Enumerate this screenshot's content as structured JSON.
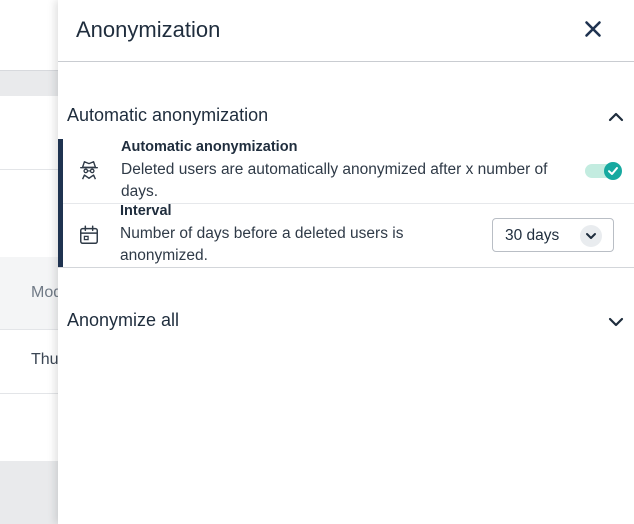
{
  "background": {
    "header_cell": "Mod",
    "row_cell": "Thu"
  },
  "drawer": {
    "title": "Anonymization",
    "close_icon": "close-icon"
  },
  "sections": [
    {
      "title": "Automatic anonymization",
      "expanded": true,
      "settings": [
        {
          "icon": "spy-icon",
          "title": "Automatic anonymization",
          "description": "Deleted users are automatically anonymized after x number of days.",
          "control": "toggle",
          "value": true
        },
        {
          "icon": "calendar-icon",
          "title": "Interval",
          "description": "Number of days before a deleted users is anonymized.",
          "control": "select",
          "value": "30 days"
        }
      ]
    },
    {
      "title": "Anonymize all",
      "expanded": false
    }
  ],
  "colors": {
    "accent": "#1f3350",
    "toggle_on": "#17a9a0",
    "toggle_track": "#c3ece0"
  }
}
